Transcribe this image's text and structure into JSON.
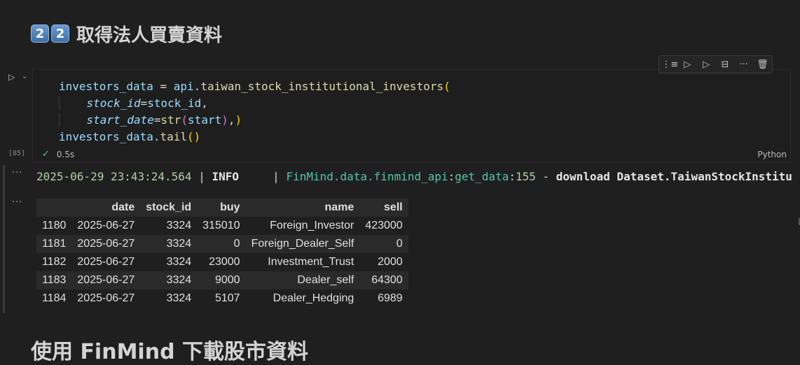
{
  "heading": {
    "num1": "2",
    "num2": "2",
    "text": "取得法人買賣資料"
  },
  "toolbar": {
    "icons": [
      "run-above-icon",
      "run-cell-icon",
      "run-below-icon",
      "split-cell-icon",
      "more-icon",
      "delete-icon"
    ]
  },
  "cell": {
    "exec_count": "[85]",
    "status_time": "0.5s",
    "language": "Python",
    "code": {
      "l1_var": "investors_data",
      "l1_eq": " = ",
      "l1_obj": "api",
      "l1_dot": ".",
      "l1_fn": "taiwan_stock_institutional_investors",
      "l1_open": "(",
      "l2_kw": "stock_id",
      "l2_eq": "=",
      "l2_val": "stock_id",
      "l2_comma": ",",
      "l3_kw": "start_date",
      "l3_eq": "=",
      "l3_fn": "str",
      "l3_open": "(",
      "l3_val": "start",
      "l3_close": ")",
      "l3_comma": ",",
      "l3_close2": ")",
      "l4_var": "investors_data",
      "l4_dot": ".",
      "l4_fn": "tail",
      "l4_parens": "()"
    }
  },
  "log": {
    "timestamp": "2025-06-29 23:43:24.564",
    "sep1": " | ",
    "level": "INFO",
    "sep2": "     | ",
    "module": "FinMind.data.finmind_api",
    "colon1": ":",
    "func": "get_data",
    "colon2": ":",
    "line": "155",
    "dash": " - ",
    "message": "download Dataset.TaiwanStockInstitu"
  },
  "table": {
    "columns": [
      "",
      "date",
      "stock_id",
      "buy",
      "name",
      "sell"
    ],
    "rows": [
      [
        "1180",
        "2025-06-27",
        "3324",
        "315010",
        "Foreign_Investor",
        "423000"
      ],
      [
        "1181",
        "2025-06-27",
        "3324",
        "0",
        "Foreign_Dealer_Self",
        "0"
      ],
      [
        "1182",
        "2025-06-27",
        "3324",
        "23000",
        "Investment_Trust",
        "2000"
      ],
      [
        "1183",
        "2025-06-27",
        "3324",
        "9000",
        "Dealer_self",
        "64300"
      ],
      [
        "1184",
        "2025-06-27",
        "3324",
        "5107",
        "Dealer_Hedging",
        "6989"
      ]
    ]
  },
  "next_heading": "使用 FinMind 下載股市資料"
}
